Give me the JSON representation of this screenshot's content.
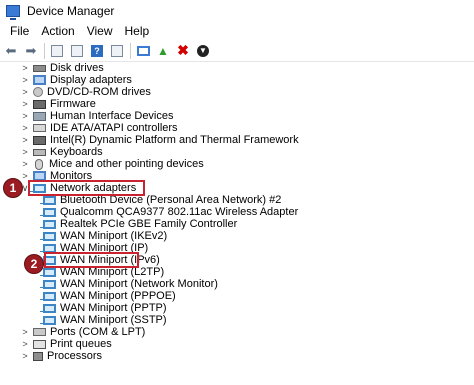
{
  "window": {
    "title": "Device Manager"
  },
  "menu": [
    "File",
    "Action",
    "View",
    "Help"
  ],
  "tree": {
    "categories_top": [
      {
        "label": "Disk drives",
        "icon": "drive-icon"
      },
      {
        "label": "Display adapters",
        "icon": "monitor-icon"
      },
      {
        "label": "DVD/CD-ROM drives",
        "icon": "dvd-icon"
      },
      {
        "label": "Firmware",
        "icon": "chip-icon"
      },
      {
        "label": "Human Interface Devices",
        "icon": "hid-icon"
      },
      {
        "label": "IDE ATA/ATAPI controllers",
        "icon": "ide-icon"
      },
      {
        "label": "Intel(R) Dynamic Platform and Thermal Framework",
        "icon": "chip-icon"
      },
      {
        "label": "Keyboards",
        "icon": "keyboard-icon"
      },
      {
        "label": "Mice and other pointing devices",
        "icon": "mouse-icon"
      },
      {
        "label": "Monitors",
        "icon": "monitor-icon"
      }
    ],
    "network": {
      "label": "Network adapters",
      "children": [
        "Bluetooth Device (Personal Area Network) #2",
        "Qualcomm QCA9377 802.11ac Wireless Adapter",
        "Realtek PCIe GBE Family Controller",
        "WAN Miniport (IKEv2)",
        "WAN Miniport (IP)",
        "WAN Miniport (IPv6)",
        "WAN Miniport (L2TP)",
        "WAN Miniport (Network Monitor)",
        "WAN Miniport (PPPOE)",
        "WAN Miniport (PPTP)",
        "WAN Miniport (SSTP)"
      ]
    },
    "categories_bottom": [
      {
        "label": "Ports (COM & LPT)",
        "icon": "port-icon"
      },
      {
        "label": "Print queues",
        "icon": "printer-icon"
      },
      {
        "label": "Processors",
        "icon": "processor-icon"
      }
    ]
  },
  "callouts": {
    "one": "1",
    "two": "2"
  },
  "colors": {
    "highlight": "#c8232f",
    "badge": "#9b1b22",
    "network_blue": "#3d86c6"
  }
}
